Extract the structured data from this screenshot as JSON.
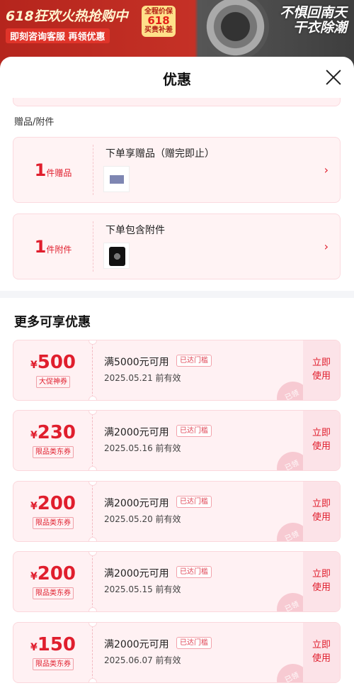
{
  "background": {
    "banner_title": "618狂欢火热抢购中",
    "banner_sub": "即刻咨询客服 再领优惠",
    "badge_top": "全程价保",
    "badge_num": "618",
    "badge_bottom": "买贵补差",
    "right_line1": "不惧回南天",
    "right_line2": "干衣除潮"
  },
  "sheet": {
    "title": "优惠",
    "gift_section_label": "赠品/附件",
    "gifts": [
      {
        "qty": "1",
        "unit": "件赠品",
        "title": "下单享赠品（赠完即止）"
      },
      {
        "qty": "1",
        "unit": "件附件",
        "title": "下单包含附件"
      }
    ],
    "more_title": "更多可享优惠",
    "coupons": [
      {
        "symbol": "¥",
        "amount": "500",
        "tag": "大促神券",
        "cond": "满5000元可用",
        "status": "已达门槛",
        "date": "2025.05.21 前有效",
        "btn1": "立即",
        "btn2": "使用",
        "stamp": "已领"
      },
      {
        "symbol": "¥",
        "amount": "230",
        "tag": "限品类东券",
        "cond": "满2000元可用",
        "status": "已达门槛",
        "date": "2025.05.16 前有效",
        "btn1": "立即",
        "btn2": "使用",
        "stamp": "已领"
      },
      {
        "symbol": "¥",
        "amount": "200",
        "tag": "限品类东券",
        "cond": "满2000元可用",
        "status": "已达门槛",
        "date": "2025.05.20 前有效",
        "btn1": "立即",
        "btn2": "使用",
        "stamp": "已领"
      },
      {
        "symbol": "¥",
        "amount": "200",
        "tag": "限品类东券",
        "cond": "满2000元可用",
        "status": "已达门槛",
        "date": "2025.05.15 前有效",
        "btn1": "立即",
        "btn2": "使用",
        "stamp": "已领"
      },
      {
        "symbol": "¥",
        "amount": "150",
        "tag": "限品类东券",
        "cond": "满2000元可用",
        "status": "已达门槛",
        "date": "2025.06.07 前有效",
        "btn1": "立即",
        "btn2": "使用",
        "stamp": "已领"
      }
    ]
  },
  "colors": {
    "accent": "#e01e2d",
    "card_bg": "#fff1f3",
    "use_button_bg": "#fce3e8"
  },
  "icons": {
    "close": "close-icon",
    "chevron": "chevron-right-icon"
  }
}
